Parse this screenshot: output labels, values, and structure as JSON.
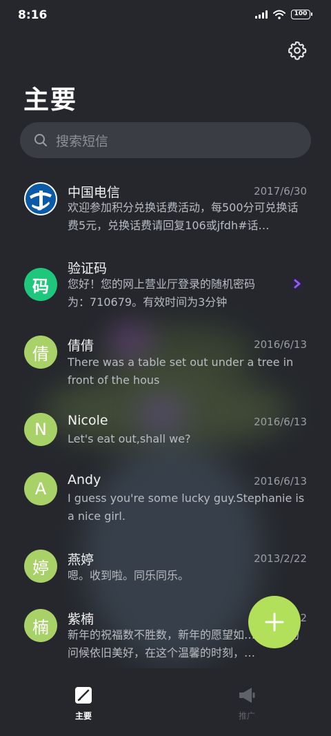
{
  "status_bar": {
    "time": "8:16",
    "battery": "100",
    "icons": [
      "signal-icon",
      "wifi-icon",
      "battery-icon"
    ]
  },
  "header": {
    "title": "主要",
    "settings_icon": "gear-icon"
  },
  "search": {
    "placeholder": "搜索短信",
    "icon": "search-icon"
  },
  "messages": [
    {
      "avatar": "",
      "avatar_style": "china-telecom-logo",
      "name": "中国电信",
      "date": "2017/6/30",
      "preview": "欢迎参加积分兑换话费活动，每500分可兑换话费5元，兑换话费请回复106或jfdh#话…"
    },
    {
      "avatar": "码",
      "avatar_color": "#1ec77c",
      "name": "验证码",
      "date": "",
      "preview": "您好！您的网上营业厅登录的随机密码为：710679。有效时间为3分钟",
      "unread_icon": "chevron-right-icon"
    },
    {
      "avatar": "倩",
      "avatar_color": "#a8d267",
      "name": "倩倩",
      "date": "2016/6/13",
      "preview": "There was a table set out under a tree in front of the hous"
    },
    {
      "avatar": "N",
      "avatar_color": "#a8d267",
      "name": "Nicole",
      "date": "2016/6/13",
      "preview": "Let's eat out,shall we?"
    },
    {
      "avatar": "A",
      "avatar_color": "#a8d267",
      "name": "Andy",
      "date": "2016/6/13",
      "preview": "I guess you're some lucky guy.Stephanie is a nice girl."
    },
    {
      "avatar": "婷",
      "avatar_color": "#a8d267",
      "name": "燕婷",
      "date": "2013/2/22",
      "preview": "嗯。收到啦。同乐同乐。"
    },
    {
      "avatar": "楠",
      "avatar_color": "#a8d267",
      "name": "紫楠",
      "date": "2",
      "preview": "新年的祝福数不胜数，新年的愿望如…，新年的问候依旧美好，在这个温馨的时刻，…"
    }
  ],
  "fab": {
    "icon": "plus-icon",
    "color": "#b2e05a"
  },
  "bottom_nav": [
    {
      "label": "主要",
      "icon": "compose-icon",
      "active": true
    },
    {
      "label": "推广",
      "icon": "megaphone-icon",
      "active": false
    }
  ],
  "colors": {
    "background": "#25272c",
    "accent": "#b2e05a",
    "search_bg": "#3a3d43"
  }
}
